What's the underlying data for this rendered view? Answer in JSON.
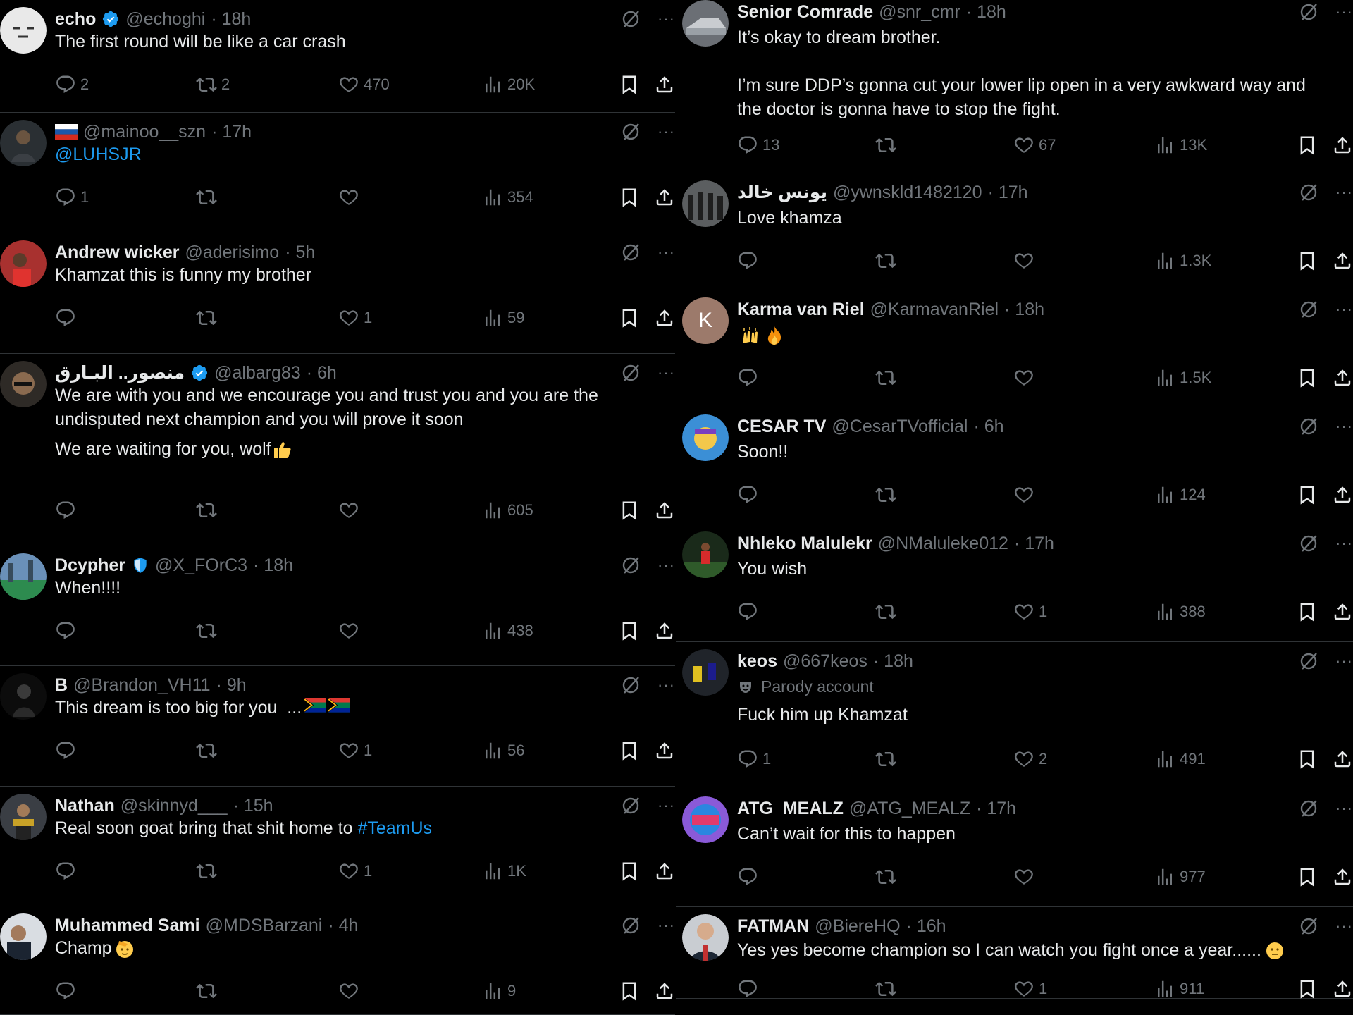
{
  "colors": {
    "background": "#000000",
    "text": "#e7e9ea",
    "muted": "#71767b",
    "link": "#1d9bf0",
    "divider": "#2f3336",
    "verified": "#1d9bf0"
  },
  "icons": [
    "reply-icon",
    "retweet-icon",
    "like-icon",
    "views-icon",
    "bookmark-icon",
    "share-icon",
    "grok-icon",
    "more-icon",
    "verified-badge-icon"
  ],
  "left": [
    {
      "name": "echo",
      "handle": "@echoghi",
      "time": "· 18h",
      "text": "The first round will be like a car crash",
      "replies": "2",
      "retweets": "2",
      "likes": "470",
      "views": "20K"
    },
    {
      "name": "",
      "handle": "@mainoo__szn",
      "time": "· 17h",
      "flag": "russia-flag-icon",
      "text": "@LUHSJR",
      "replies": "1",
      "retweets": "",
      "likes": "",
      "views": "354"
    },
    {
      "name": "Andrew wicker",
      "handle": "@aderisimo",
      "time": "· 5h",
      "text": "Khamzat this is funny my brother",
      "replies": "",
      "retweets": "",
      "likes": "1",
      "views": "59"
    },
    {
      "name": "منصور.. البـارق",
      "handle": "@albarg83",
      "time": "· 6h",
      "text": "We are with you and we encourage you and trust you and you are the undisputed next champion and you will prove it soon",
      "text2": "We are waiting for you, wolf",
      "replies": "",
      "retweets": "",
      "likes": "",
      "views": "605"
    },
    {
      "name": "Dcypher",
      "handle": "@X_FOrC3",
      "time": "· 18h",
      "text": "When!!!!",
      "replies": "",
      "retweets": "",
      "likes": "",
      "views": "438"
    },
    {
      "name": "B",
      "handle": "@Brandon_VH11",
      "time": "· 9h",
      "text": "This dream is too big for you  ...",
      "replies": "",
      "retweets": "",
      "likes": "1",
      "views": "56"
    },
    {
      "name": "Nathan",
      "handle": "@skinnyd___",
      "time": "· 15h",
      "text": "Real soon goat bring that shit home to ",
      "hashtag": "#TeamUs",
      "replies": "",
      "retweets": "",
      "likes": "1",
      "views": "1K"
    },
    {
      "name": "Muhammed Sami",
      "handle": "@MDSBarzani",
      "time": "· 4h",
      "text": "Champ",
      "replies": "",
      "retweets": "",
      "likes": "",
      "views": "9"
    }
  ],
  "right": [
    {
      "name": "Senior Comrade",
      "handle": "@snr_cmr",
      "time": "· 18h",
      "text": "It’s okay to dream brother.\n\nI’m sure DDP’s gonna cut your lower lip open in a very awkward way and the doctor is gonna have to stop the fight.",
      "replies": "13",
      "retweets": "",
      "likes": "67",
      "views": "13K"
    },
    {
      "name": "يونس خالد",
      "handle": "@ywnskld1482120",
      "time": "· 17h",
      "text": "Love khamza",
      "replies": "",
      "retweets": "",
      "likes": "",
      "views": "1.3K"
    },
    {
      "name": "Karma van Riel",
      "handle": "@KarmavanRiel",
      "time": "· 18h",
      "avatar_letter": "K",
      "text": "",
      "replies": "",
      "retweets": "",
      "likes": "",
      "views": "1.5K"
    },
    {
      "name": "CESAR TV",
      "handle": "@CesarTVofficial",
      "time": "· 6h",
      "text": "Soon!!",
      "replies": "",
      "retweets": "",
      "likes": "",
      "views": "124"
    },
    {
      "name": "Nhleko Malulekr",
      "handle": "@NMaluleke012",
      "time": "· 17h",
      "text": "You wish",
      "replies": "",
      "retweets": "",
      "likes": "1",
      "views": "388"
    },
    {
      "name": "keos",
      "handle": "@667keos",
      "time": "· 18h",
      "parody": "Parody account",
      "text": "Fuck him up Khamzat",
      "replies": "1",
      "retweets": "",
      "likes": "2",
      "views": "491"
    },
    {
      "name": "ATG_MEALZ",
      "handle": "@ATG_MEALZ",
      "time": "· 17h",
      "text": "Can’t wait for this to happen",
      "replies": "",
      "retweets": "",
      "likes": "",
      "views": "977"
    },
    {
      "name": "FATMAN",
      "handle": "@BiereHQ",
      "time": "· 16h",
      "text": "Yes yes become champion so I can watch you fight once a year......",
      "replies": "",
      "retweets": "",
      "likes": "1",
      "views": "911"
    }
  ]
}
